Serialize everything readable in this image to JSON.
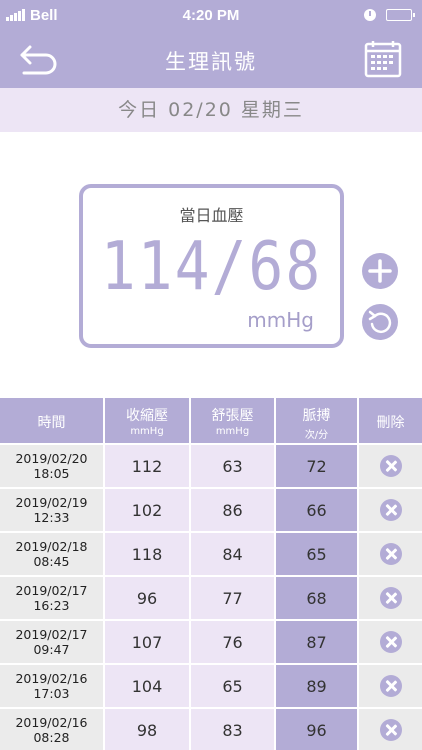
{
  "status_bar": {
    "carrier": "Bell",
    "time": "4:20 PM"
  },
  "nav": {
    "title": "生理訊號"
  },
  "date_bar": {
    "text": "今日 02/20 星期三"
  },
  "bp_display": {
    "label": "當日血壓",
    "reading": "114/68",
    "unit": "mmHg"
  },
  "table": {
    "headers": [
      {
        "main": "時間",
        "sub": ""
      },
      {
        "main": "收縮壓",
        "sub": "mmHg"
      },
      {
        "main": "舒張壓",
        "sub": "mmHg"
      },
      {
        "main": "脈搏",
        "sub": "次/分"
      },
      {
        "main": "刪除",
        "sub": ""
      }
    ],
    "rows": [
      {
        "date": "2019/02/20",
        "time": "18:05",
        "systolic": "112",
        "diastolic": "63",
        "pulse": "72"
      },
      {
        "date": "2019/02/19",
        "time": "12:33",
        "systolic": "102",
        "diastolic": "86",
        "pulse": "66"
      },
      {
        "date": "2019/02/18",
        "time": "08:45",
        "systolic": "118",
        "diastolic": "84",
        "pulse": "65"
      },
      {
        "date": "2019/02/17",
        "time": "16:23",
        "systolic": "96",
        "diastolic": "77",
        "pulse": "68"
      },
      {
        "date": "2019/02/17",
        "time": "09:47",
        "systolic": "107",
        "diastolic": "76",
        "pulse": "87"
      },
      {
        "date": "2019/02/16",
        "time": "17:03",
        "systolic": "104",
        "diastolic": "65",
        "pulse": "89"
      },
      {
        "date": "2019/02/16",
        "time": "08:28",
        "systolic": "98",
        "diastolic": "83",
        "pulse": "96"
      }
    ]
  },
  "icons": {
    "back": "back-arrow-icon",
    "calendar": "calendar-icon",
    "add": "plus-icon",
    "reset": "refresh-icon",
    "delete": "close-circle-icon"
  },
  "colors": {
    "accent": "#b3acd6",
    "light_accent": "#ede5f5",
    "gray_cell": "#ebebeb"
  }
}
